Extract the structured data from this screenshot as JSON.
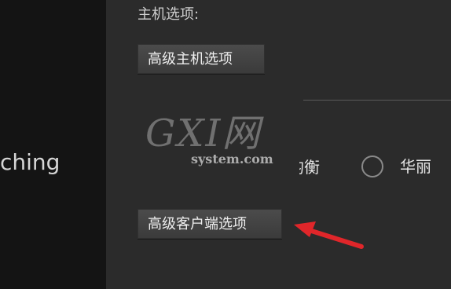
{
  "left_panel": {
    "partial_text": "ching"
  },
  "host_options": {
    "heading": "主机选项:",
    "advanced_button_label": "高级主机选项"
  },
  "graphics_quality": {
    "partial_option_label": "均衡",
    "option_label": "华丽"
  },
  "client_options": {
    "advanced_button_label": "高级客户端选项"
  },
  "watermark": {
    "letters": "GXI网",
    "subtitle": "system.com"
  },
  "colors": {
    "left_background": "#141414",
    "main_background": "#2b2b2b",
    "button_background": "#444444",
    "annotation_arrow": "#e0262a"
  },
  "icons": {
    "radio": "radio-unselected-icon",
    "arrow": "red-annotation-arrow-icon"
  }
}
